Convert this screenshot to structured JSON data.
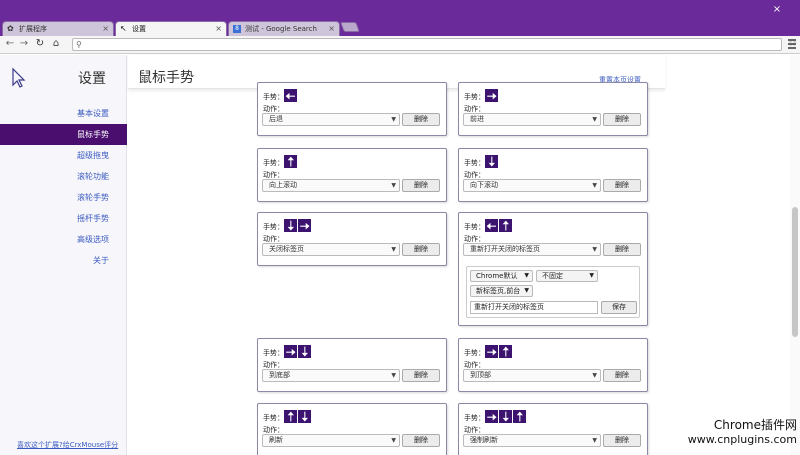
{
  "tabs": [
    {
      "label": "扩展程序",
      "active": false,
      "icon": "puzzle-icon"
    },
    {
      "label": "设置",
      "active": true,
      "icon": "cursor-icon"
    },
    {
      "label": "测试 - Google Search",
      "active": false,
      "icon": "google-icon"
    }
  ],
  "toolbar": {
    "url": ""
  },
  "sidebar": {
    "title": "设置",
    "items": [
      {
        "label": "基本设置",
        "active": false
      },
      {
        "label": "鼠标手势",
        "active": true
      },
      {
        "label": "超级拖曳",
        "active": false
      },
      {
        "label": "滚轮功能",
        "active": false
      },
      {
        "label": "滚轮手势",
        "active": false
      },
      {
        "label": "摇杆手势",
        "active": false
      },
      {
        "label": "高级选项",
        "active": false
      },
      {
        "label": "关于",
        "active": false
      }
    ],
    "footer": "喜欢这个扩展?给CrxMouse评分"
  },
  "header": {
    "title": "鼠标手势",
    "reset_link": "重置本页设置"
  },
  "labels": {
    "gesture": "手势：",
    "action": "动作：",
    "delete": "删除",
    "save": "保存"
  },
  "cards": [
    {
      "gesture": [
        "left"
      ],
      "action": "后退"
    },
    {
      "gesture": [
        "right"
      ],
      "action": "前进"
    },
    {
      "gesture": [
        "up"
      ],
      "action": "向上滚动"
    },
    {
      "gesture": [
        "down"
      ],
      "action": "向下滚动"
    },
    {
      "gesture": [
        "down",
        "right"
      ],
      "action": "关闭标签页"
    },
    {
      "gesture": [
        "left",
        "up"
      ],
      "action": "重新打开关闭的标签页"
    },
    {
      "gesture": [
        "right",
        "down"
      ],
      "action": "到底部"
    },
    {
      "gesture": [
        "right",
        "up"
      ],
      "action": "到顶部"
    },
    {
      "gesture": [
        "up",
        "down"
      ],
      "action": "刷新"
    },
    {
      "gesture": [
        "right",
        "down",
        "up"
      ],
      "action": "强制刷新"
    }
  ],
  "subpanel": {
    "option1": "Chrome默认",
    "option2": "不固定",
    "option3": "新标签页,前台",
    "input_value": "重新打开关闭的标签页"
  },
  "watermark": {
    "line1": "Chrome插件网",
    "line2": "www.cnplugins.com"
  },
  "colors": {
    "brand_purple": "#6a2a9a",
    "active_nav": "#4a0f6e",
    "arrow_bg": "#3c1470",
    "link": "#3a5ac0"
  }
}
